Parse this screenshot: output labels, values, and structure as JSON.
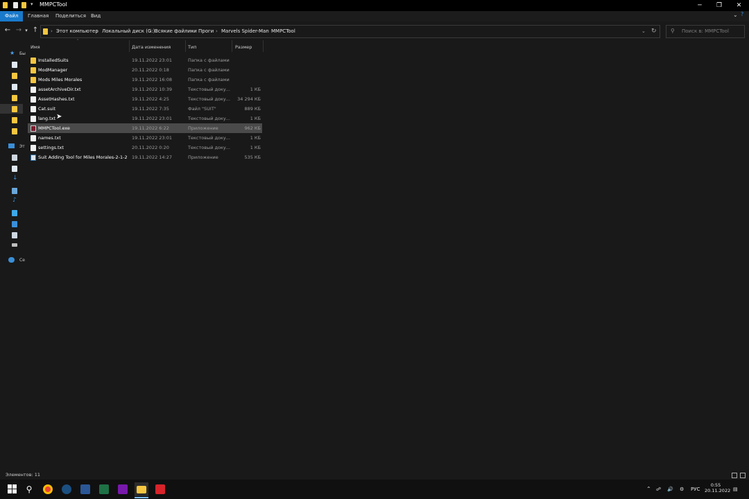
{
  "window": {
    "title": "MMPCTool"
  },
  "ribbon": {
    "tabs": [
      {
        "label": "Файл",
        "active": true
      },
      {
        "label": "Главная"
      },
      {
        "label": "Поделиться"
      },
      {
        "label": "Вид"
      }
    ]
  },
  "address": {
    "breadcrumbs": [
      "Этот компьютер",
      "Локальный диск (G:)",
      "Всякие файлики",
      "Проги",
      "Marvels Spider-Man",
      "MMPCTool"
    ],
    "search_placeholder": "Поиск в: MMPCTool"
  },
  "columns": {
    "name": "Имя",
    "date": "Дата изменения",
    "type": "Тип",
    "size": "Размер"
  },
  "files": [
    {
      "name": "InstalledSuits",
      "date": "19.11.2022 23:01",
      "type": "Папка с файлами",
      "size": "",
      "icon": "folder-icon"
    },
    {
      "name": "ModManager",
      "date": "20.11.2022 0:18",
      "type": "Папка с файлами",
      "size": "",
      "icon": "folder-icon"
    },
    {
      "name": "Mods Miles Morales",
      "date": "19.11.2022 16:08",
      "type": "Папка с файлами",
      "size": "",
      "icon": "folder-icon"
    },
    {
      "name": "assetArchiveDir.txt",
      "date": "19.11.2022 10:39",
      "type": "Текстовый доку...",
      "size": "1 КБ",
      "icon": "text-file-icon"
    },
    {
      "name": "AssetHashes.txt",
      "date": "19.11.2022 4:25",
      "type": "Текстовый доку...",
      "size": "34 294 КБ",
      "icon": "text-file-icon"
    },
    {
      "name": "Cat.suit",
      "date": "19.11.2022 7:35",
      "type": "Файл \"SUIT\"",
      "size": "889 КБ",
      "icon": "file-icon"
    },
    {
      "name": "lang.txt",
      "date": "19.11.2022 23:01",
      "type": "Текстовый доку...",
      "size": "1 КБ",
      "icon": "text-file-icon"
    },
    {
      "name": "MMPCTool.exe",
      "date": "19.11.2022 6:22",
      "type": "Приложение",
      "size": "962 КБ",
      "icon": "exe-icon",
      "selected": true
    },
    {
      "name": "names.txt",
      "date": "19.11.2022 23:01",
      "type": "Текстовый доку...",
      "size": "1 КБ",
      "icon": "text-file-icon"
    },
    {
      "name": "settings.txt",
      "date": "20.11.2022 0:20",
      "type": "Текстовый доку...",
      "size": "1 КБ",
      "icon": "text-file-icon"
    },
    {
      "name": "Suit Adding Tool for Miles Morales-2-1-2...",
      "date": "19.11.2022 14:27",
      "type": "Приложение",
      "size": "535 КБ",
      "icon": "app-icon"
    }
  ],
  "nav_pane": {
    "labels": [
      "Бы",
      "Эт",
      "Се"
    ]
  },
  "status": {
    "text": "Элементов: 11"
  },
  "tray": {
    "lang": "РУС",
    "time": "0:55",
    "date": "20.11.2022"
  },
  "colors": {
    "accent": "#1979ca",
    "folder": "#f6c640",
    "selection": "#4a4a4a"
  }
}
